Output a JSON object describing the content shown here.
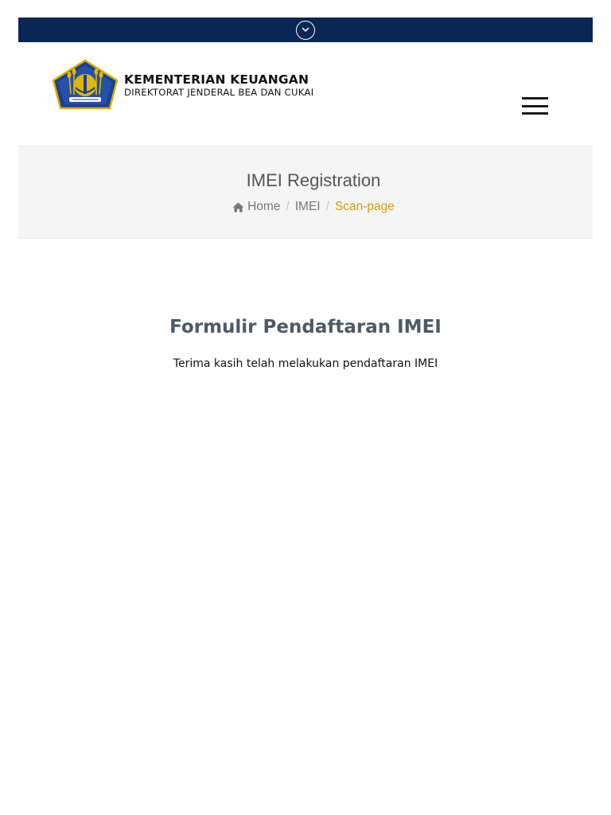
{
  "top_bar": {
    "toggle_icon": "chevron-down-icon",
    "color": "#0a2655"
  },
  "logo": {
    "emblem_icon": "kemenkeu-emblem",
    "title": "KEMENTERIAN KEUANGAN",
    "subtitle": "DIREKTORAT JENDERAL BEA DAN CUKAI"
  },
  "header": {
    "menu_icon": "hamburger-menu-icon"
  },
  "page_header": {
    "title": "IMEI Registration",
    "breadcrumb": {
      "home_icon": "home-icon",
      "home": "Home",
      "separator": "/",
      "imei": "IMEI",
      "current": "Scan-page"
    },
    "accent_color": "#c8a012"
  },
  "content": {
    "form_title": "Formulir Pendaftaran IMEI",
    "message": "Terima kasih telah melakukan pendaftaran IMEI"
  }
}
